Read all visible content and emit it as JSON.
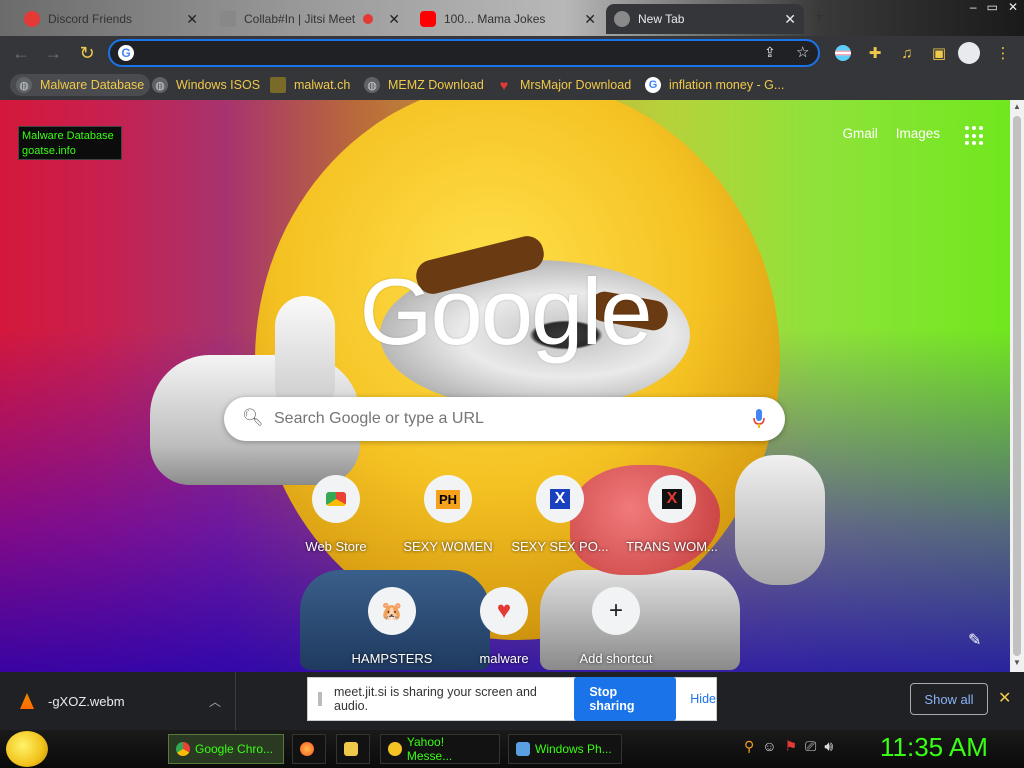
{
  "tabs": [
    {
      "label": "Discord Friends",
      "icon": "discord-icon",
      "active": false
    },
    {
      "label": "Collab#In | Jitsi Meet",
      "icon": "pen-icon",
      "active": false
    },
    {
      "label": "100... Mama Jokes",
      "icon": "youtube-icon",
      "active": false
    },
    {
      "label": "New Tab",
      "icon": "chrome-icon",
      "active": true
    }
  ],
  "omnibox": {
    "value": "",
    "placeholder": ""
  },
  "bookmarks": [
    {
      "label": "Malware Database",
      "icon": "globe-icon"
    },
    {
      "label": "Windows ISOS",
      "icon": "globe-icon"
    },
    {
      "label": "malwat.ch",
      "icon": "malwatch-icon"
    },
    {
      "label": "MEMZ Download",
      "icon": "globe-icon"
    },
    {
      "label": "MrsMajor Download",
      "icon": "heart-icon"
    },
    {
      "label": "inflation money - G...",
      "icon": "google-icon"
    }
  ],
  "tooltip": {
    "line1": "Malware Database",
    "line2": "goatse.info"
  },
  "ntp": {
    "logo": "Google",
    "top_links": [
      "Gmail",
      "Images"
    ],
    "search_placeholder": "Search Google or type a URL",
    "shortcuts": [
      {
        "label": "Web Store",
        "glyph": "",
        "icon": "webstore-icon"
      },
      {
        "label": "SEXY WOMEN",
        "glyph": "PH",
        "icon": "ph-icon"
      },
      {
        "label": "SEXY SEX PO...",
        "glyph": "X",
        "icon": "x-blue-icon"
      },
      {
        "label": "TRANS WOM...",
        "glyph": "X",
        "icon": "x-red-icon"
      },
      {
        "label": "HAMPSTERS",
        "glyph": "🐹",
        "icon": "hamster-icon"
      },
      {
        "label": "malware",
        "glyph": "♥",
        "icon": "heart-icon"
      },
      {
        "label": "Add shortcut",
        "glyph": "+",
        "icon": "plus-icon"
      }
    ]
  },
  "download": {
    "filename": "-gXOZ.webm"
  },
  "share_bar": {
    "message": "meet.jit.si is sharing your screen and audio.",
    "stop_label": "Stop sharing",
    "hide_label": "Hide"
  },
  "show_all_label": "Show all",
  "taskbar": {
    "buttons": [
      {
        "label": "Google Chro...",
        "icon": "chrome-icon",
        "active": true
      },
      {
        "label": "",
        "icon": "firefox-icon",
        "active": false
      },
      {
        "label": "",
        "icon": "folder-icon",
        "active": false
      },
      {
        "label": "Yahoo! Messe...",
        "icon": "yahoo-icon",
        "active": false
      },
      {
        "label": "Windows Ph...",
        "icon": "photo-icon",
        "active": false
      }
    ],
    "clock": "11:35 AM"
  },
  "colors": {
    "accent": "#1a73e8",
    "bookmark_text": "#f0c94a",
    "taskbar_text": "#39ff14"
  }
}
